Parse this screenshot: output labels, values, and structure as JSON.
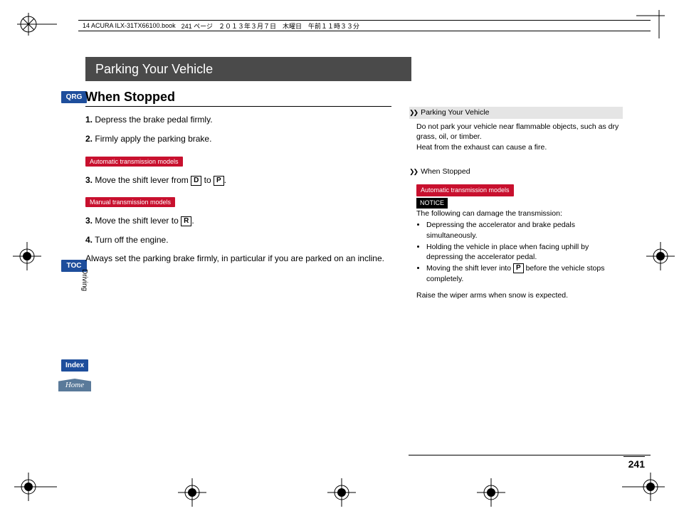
{
  "header": {
    "file": "14 ACURA ILX-31TX66100.book",
    "page_marker": "241 ページ",
    "date": "２０１３年３月７日　木曜日　午前１１時３３分"
  },
  "title": "Parking Your Vehicle",
  "subtitle": "When Stopped",
  "steps": {
    "s1_num": "1.",
    "s1": "Depress the brake pedal firmly.",
    "s2_num": "2.",
    "s2": "Firmly apply the parking brake.",
    "auto_chip": "Automatic transmission models",
    "s3a_num": "3.",
    "s3a_pre": "Move the shift lever from ",
    "gear_d": "D",
    "s3a_mid": " to ",
    "gear_p": "P",
    "s3a_post": ".",
    "manual_chip": "Manual transmission models",
    "s3m_num": "3.",
    "s3m_pre": "Move the shift lever to ",
    "gear_r": "R",
    "s3m_post": ".",
    "s4_num": "4.",
    "s4": "Turn off the engine.",
    "note": "Always set the parking brake firmly, in particular if you are parked on an incline."
  },
  "nav": {
    "qrg": "QRG",
    "toc": "TOC",
    "index": "Index",
    "home": "Home",
    "section": "Driving"
  },
  "right": {
    "h1": "Parking Your Vehicle",
    "p1a": "Do not park your vehicle near flammable objects, such as dry grass, oil, or timber.",
    "p1b": "Heat from the exhaust can cause a fire.",
    "h2": "When Stopped",
    "chip": "Automatic transmission models",
    "notice": "NOTICE",
    "lead": "The following can damage the transmission:",
    "b1": "Depressing the accelerator and brake pedals simultaneously.",
    "b2": "Holding the vehicle in place when facing uphill by depressing the accelerator pedal.",
    "b3_pre": "Moving the shift lever into ",
    "b3_gear": "P",
    "b3_post": " before the vehicle stops completely.",
    "wiper": "Raise the wiper arms when snow is expected."
  },
  "page_number": "241"
}
